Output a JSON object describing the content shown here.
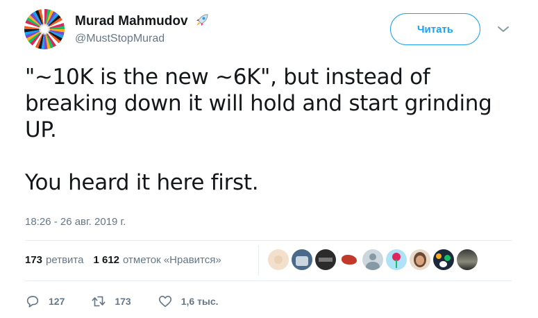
{
  "author": {
    "name": "Murad Mahmudov",
    "handle": "@MustStopMurad",
    "badge_icon": "rocket-icon"
  },
  "follow_button": {
    "label": "Читать"
  },
  "tweet": {
    "text": "\"~10K is the new ~6K\", but instead of breaking down it will hold and start grinding UP.\n\nYou heard it here first.",
    "timestamp": "18:26 - 26 авг. 2019 г."
  },
  "stats": {
    "retweets_count": "173",
    "retweets_label": "ретвита",
    "likes_count": "1 612",
    "likes_label": "отметок «Нравится»"
  },
  "likers_count": 9,
  "actions": {
    "reply_count": "127",
    "retweet_count": "173",
    "like_count": "1,6 тыс."
  },
  "colors": {
    "accent": "#1da1f2",
    "text": "#14171a",
    "muted": "#657786",
    "divider": "#e6ecf0"
  }
}
